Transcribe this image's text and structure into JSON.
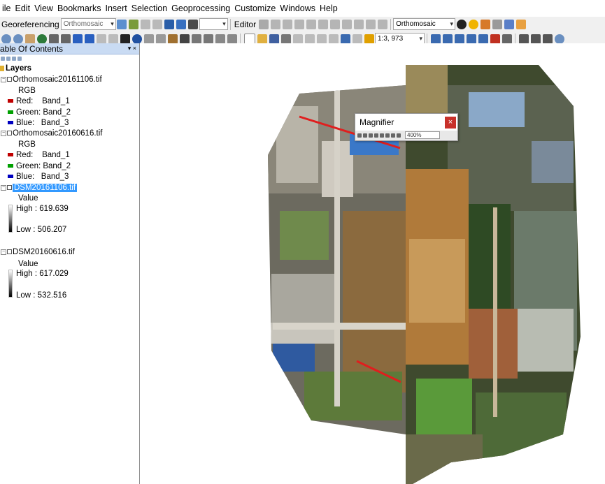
{
  "menu": [
    "ile",
    "Edit",
    "View",
    "Bookmarks",
    "Insert",
    "Selection",
    "Geoprocessing",
    "Customize",
    "Windows",
    "Help"
  ],
  "toolbar": {
    "georef_label": "Georeferencing",
    "georef_layer": "Orthomosaic",
    "editor_label": "Editor",
    "layer_combo": "Orthomosaic",
    "scale": "1:3, 973"
  },
  "toc": {
    "title": "able Of Contents",
    "pin": "▾ ×",
    "layers_label": "Layers",
    "ortho1": {
      "name": "Orthomosaic20161106.tif",
      "rgb": "RGB",
      "red": "Red:    Band_1",
      "green": "Green: Band_2",
      "blue": "Blue:   Band_3"
    },
    "ortho2": {
      "name": "Orthomosaic20160616.tif",
      "rgb": "RGB",
      "red": "Red:    Band_1",
      "green": "Green: Band_2",
      "blue": "Blue:   Band_3"
    },
    "dsm1": {
      "name": "DSM20161106.tif",
      "value": "Value",
      "high": "High : 619.639",
      "low": "Low : 506.207"
    },
    "dsm2": {
      "name": "DSM20160616.tif",
      "value": "Value",
      "high": "High : 617.029",
      "low": "Low : 532.516"
    }
  },
  "magnifier": {
    "title": "Magnifier",
    "close": "×",
    "zoom": "400%"
  },
  "colors": {
    "red_band": "#c00000",
    "green_band": "#00a000",
    "blue_band": "#0000c0",
    "selection": "#3399ff"
  }
}
